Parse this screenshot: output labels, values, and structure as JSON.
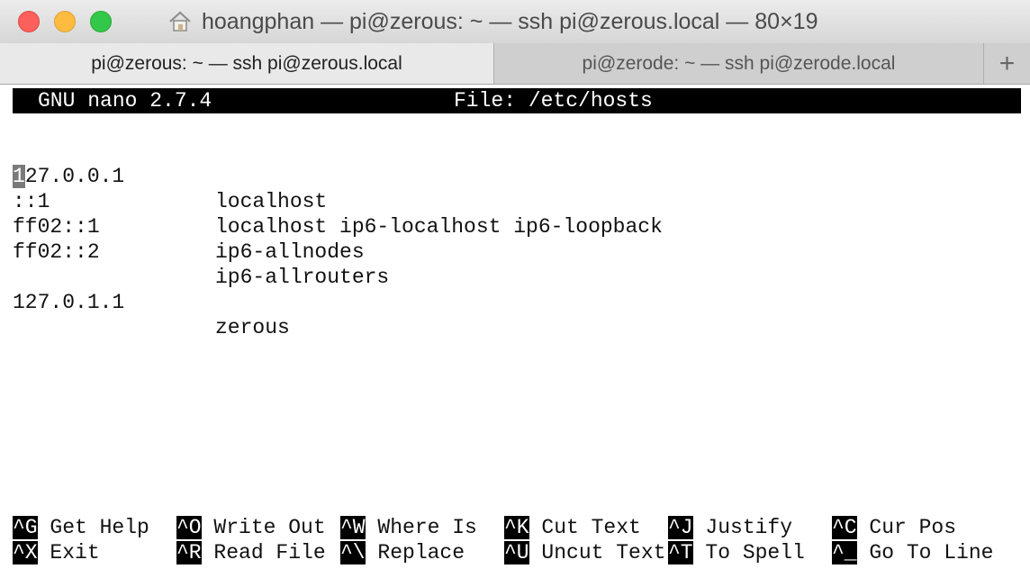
{
  "window": {
    "title": "hoangphan — pi@zerous: ~ — ssh pi@zerous.local — 80×19"
  },
  "tabs": [
    {
      "label": "pi@zerous: ~ — ssh pi@zerous.local"
    },
    {
      "label": "pi@zerode: ~ — ssh pi@zerode.local"
    }
  ],
  "new_tab": "+",
  "nano": {
    "version": "GNU nano 2.7.4",
    "file": "File: /etc/hosts",
    "lines": [
      {
        "addr": "127.0.0.1",
        "cursor_char": "1",
        "addr_rest": "27.0.0.1",
        "hosts": "localhost"
      },
      {
        "addr": "::1",
        "hosts": "localhost ip6-localhost ip6-loopback"
      },
      {
        "addr": "ff02::1",
        "hosts": "ip6-allnodes"
      },
      {
        "addr": "ff02::2",
        "hosts": "ip6-allrouters"
      },
      {
        "addr": "127.0.1.1",
        "hosts": "zerous"
      }
    ],
    "shortcuts_row1": [
      {
        "key": "^G",
        "label": "Get Help"
      },
      {
        "key": "^O",
        "label": "Write Out"
      },
      {
        "key": "^W",
        "label": "Where Is"
      },
      {
        "key": "^K",
        "label": "Cut Text"
      },
      {
        "key": "^J",
        "label": "Justify"
      },
      {
        "key": "^C",
        "label": "Cur Pos"
      }
    ],
    "shortcuts_row2": [
      {
        "key": "^X",
        "label": "Exit"
      },
      {
        "key": "^R",
        "label": "Read File"
      },
      {
        "key": "^\\",
        "label": "Replace"
      },
      {
        "key": "^U",
        "label": "Uncut Text"
      },
      {
        "key": "^T",
        "label": "To Spell"
      },
      {
        "key": "^_",
        "label": "Go To Line"
      }
    ]
  },
  "icons": {
    "close": "close-traffic-light",
    "minimize": "minimize-traffic-light",
    "maximize": "zoom-traffic-light",
    "home": "home-icon"
  },
  "colors": {
    "close": "#fc605c",
    "minimize": "#fdbc40",
    "maximize": "#34c84a",
    "nano_bar": "#000000"
  }
}
